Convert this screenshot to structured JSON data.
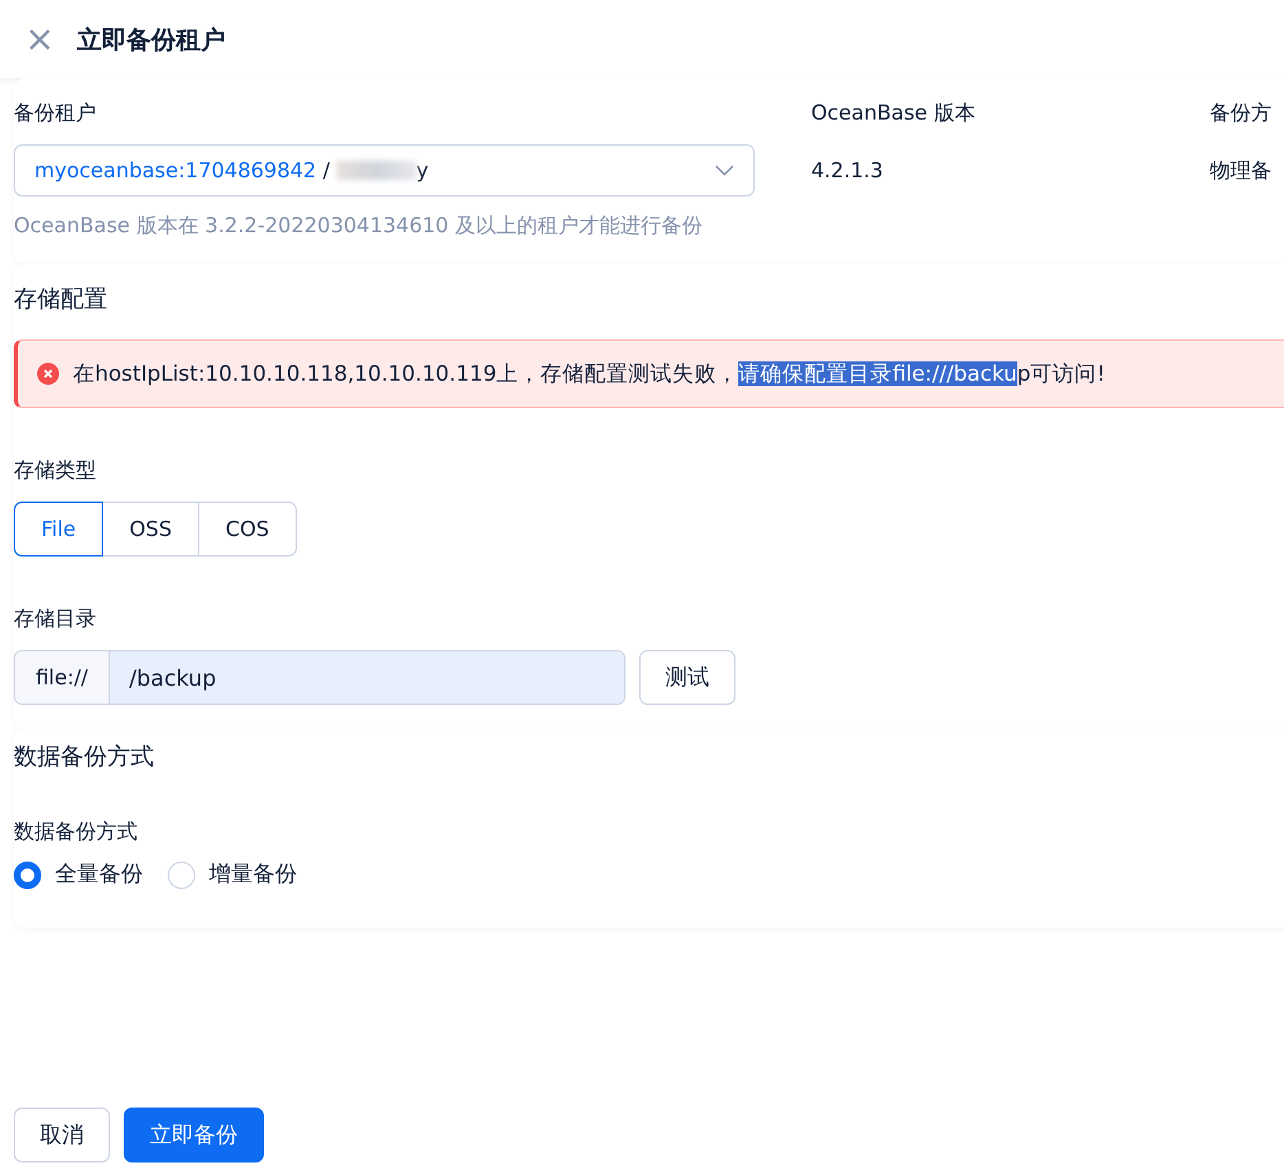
{
  "header": {
    "close_icon": "×",
    "title": "立即备份租户"
  },
  "tenant_card": {
    "fields": [
      {
        "label": "备份租户",
        "kind": "select",
        "value": "myoceanbase:1704869842",
        "separator": " / ",
        "suffix": "y",
        "redacted": true
      },
      {
        "label": "OceanBase 版本",
        "kind": "text",
        "value": "4.2.1.3"
      },
      {
        "label": "备份方",
        "kind": "text",
        "value": "物理备"
      }
    ],
    "help": "OceanBase 版本在 3.2.2-20220304134610 及以上的租户才能进行备份"
  },
  "storage": {
    "title": "存储配置",
    "alert": {
      "before": "在hostIpList:10.10.10.118,10.10.10.119上，存储配置测试失败，",
      "selected": "请确保配置目录file:///backu",
      "after": "p可访问!"
    },
    "type_label": "存储类型",
    "types": [
      {
        "label": "File",
        "selected": true
      },
      {
        "label": "OSS",
        "selected": false
      },
      {
        "label": "COS",
        "selected": false
      }
    ],
    "dir_label": "存储目录",
    "prefix": "file://",
    "dir_value": "/backup",
    "test_button": "测试"
  },
  "data_backup": {
    "title": "数据备份方式",
    "label": "数据备份方式",
    "options": [
      {
        "label": "全量备份",
        "selected": true
      },
      {
        "label": "增量备份",
        "selected": false
      }
    ]
  },
  "footer": {
    "buttons": [
      {
        "label": "取消",
        "kind": "default"
      },
      {
        "label": "立即备份",
        "kind": "primary"
      }
    ]
  }
}
